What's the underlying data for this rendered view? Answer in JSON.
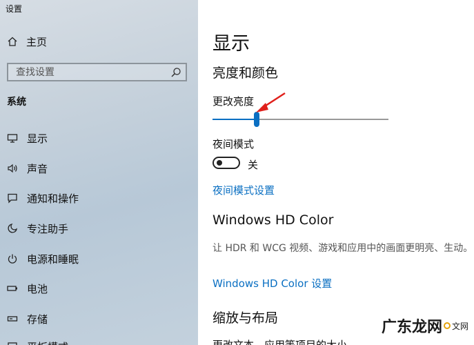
{
  "window": {
    "title": "设置"
  },
  "sidebar": {
    "home_label": "主页",
    "search_placeholder": "查找设置",
    "section_header": "系统",
    "items": [
      {
        "label": "显示",
        "icon": "monitor-icon"
      },
      {
        "label": "声音",
        "icon": "speaker-icon"
      },
      {
        "label": "通知和操作",
        "icon": "notification-icon"
      },
      {
        "label": "专注助手",
        "icon": "moon-icon"
      },
      {
        "label": "电源和睡眠",
        "icon": "power-icon"
      },
      {
        "label": "电池",
        "icon": "battery-icon"
      },
      {
        "label": "存储",
        "icon": "storage-icon"
      },
      {
        "label": "平板模式",
        "icon": "tablet-icon"
      }
    ]
  },
  "main": {
    "title": "显示",
    "brightness_section": "亮度和颜色",
    "brightness_label": "更改亮度",
    "brightness_level": 0.25,
    "night_light_label": "夜间模式",
    "night_light_state": "关",
    "night_light_link": "夜间模式设置",
    "hd_color_title": "Windows HD Color",
    "hd_color_desc": "让 HDR 和 WCG 视频、游戏和应用中的画面更明亮、生动。",
    "hd_color_link": "Windows HD Color 设置",
    "scale_section": "缩放与布局",
    "scale_text_label": "更改文本、应用等项目的大小"
  },
  "watermark": {
    "text": "广东龙网",
    "tail": "文网"
  },
  "colors": {
    "accent": "#0a6fc2",
    "arrow": "#e0201b"
  }
}
